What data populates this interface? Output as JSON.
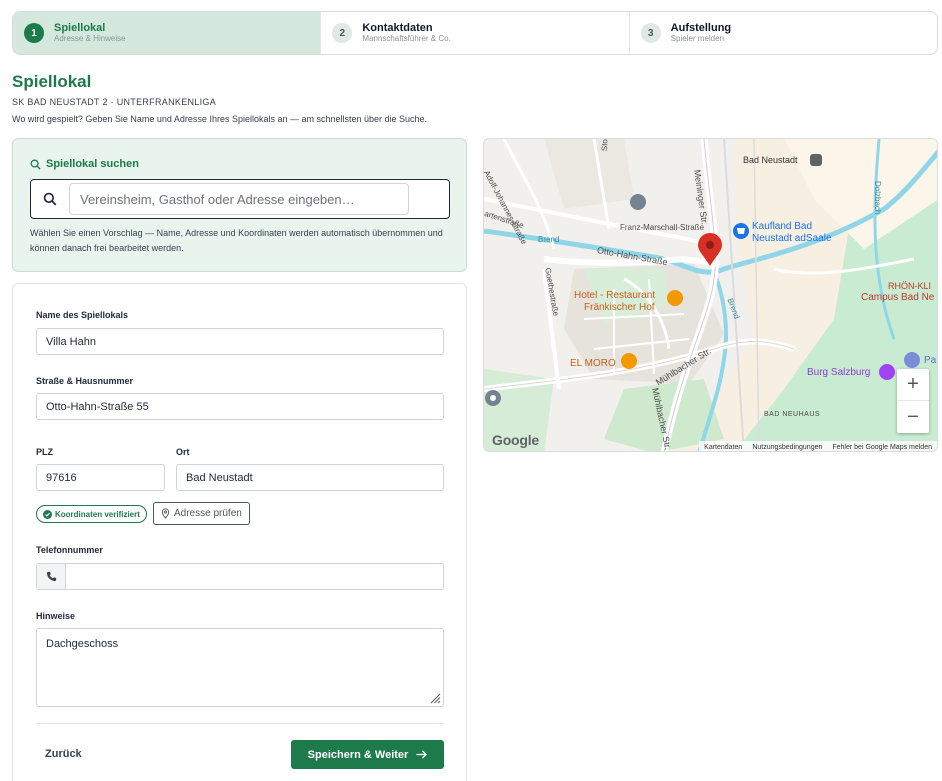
{
  "stepper": {
    "steps": [
      {
        "num": "1",
        "title": "Spiellokal",
        "sub": "Adresse & Hinweise"
      },
      {
        "num": "2",
        "title": "Kontaktdaten",
        "sub": "Mannschaftsführer & Co."
      },
      {
        "num": "3",
        "title": "Aufstellung",
        "sub": "Spieler melden"
      }
    ],
    "active_color": "#1d7a4b"
  },
  "header": {
    "title": "Spiellokal",
    "subtitle": "SK BAD NEUSTADT 2 · UNTERFRANKENLIGA",
    "description": "Wo wird gespielt? Geben Sie Name und Adresse Ihres Spiellokals an — am schnellsten über die Suche."
  },
  "search": {
    "title": "Spiellokal suchen",
    "placeholder": "Vereinsheim, Gasthof oder Adresse eingeben…",
    "help": "Wählen Sie einen Vorschlag — Name, Adresse und Koordinaten werden automatisch übernommen und können danach frei bearbeitet werden."
  },
  "form": {
    "name_label": "Name des Spiellokals",
    "name_value": "Villa Hahn",
    "street_label": "Straße & Hausnummer",
    "street_value": "Otto-Hahn-Straße 55",
    "plz_label": "PLZ",
    "plz_value": "97616",
    "ort_label": "Ort",
    "ort_value": "Bad Neustadt",
    "verified_badge": "Koordinaten verifiziert",
    "check_button": "Adresse prüfen",
    "phone_label": "Telefonnummer",
    "phone_value": "",
    "notes_label": "Hinweise",
    "notes_value": "Dachgeschoss",
    "back_button": "Zurück",
    "save_button": "Speichern & Weiter"
  },
  "map": {
    "labels": {
      "adolf": "Adolf-Johannes-Straße",
      "stockgasse": "Stockgasse",
      "meininger": "Meininger Str.",
      "bad_neustadt": "Bad Neustadt",
      "franz": "Franz-Marschall-Straße",
      "kaufland": "Kaufland Bad Neustadt adSaale",
      "kaufland_1": "Kaufland Bad",
      "kaufland_2": "Neustadt adSaale",
      "dolzbach": "Dolzbach",
      "gartenstr": "artenstraße",
      "brend_1": "Brend",
      "otto": "Otto-Hahn-Straße",
      "goethe": "Goethestraße",
      "hotel_1": "Hotel - Restaurant",
      "hotel_2": "Fränkischer Hof",
      "brend_2": "Brend",
      "rhoen_1": "RHÖN-KLI",
      "rhoen_2": "Campus Bad Ne",
      "elmoro": "EL MORO",
      "muehl": "Mühlbacher Str.",
      "pa": "Pa",
      "burg": "Burg Salzburg",
      "muehl2": "Mühlbacher Str.",
      "neuhaus": "BAD NEUHAUS"
    },
    "zoom_in": "+",
    "zoom_out": "−",
    "logo": "Google",
    "attribution": [
      "Kartendaten",
      "Nutzungsbedingungen",
      "Fehler bei Google Maps melden"
    ]
  }
}
